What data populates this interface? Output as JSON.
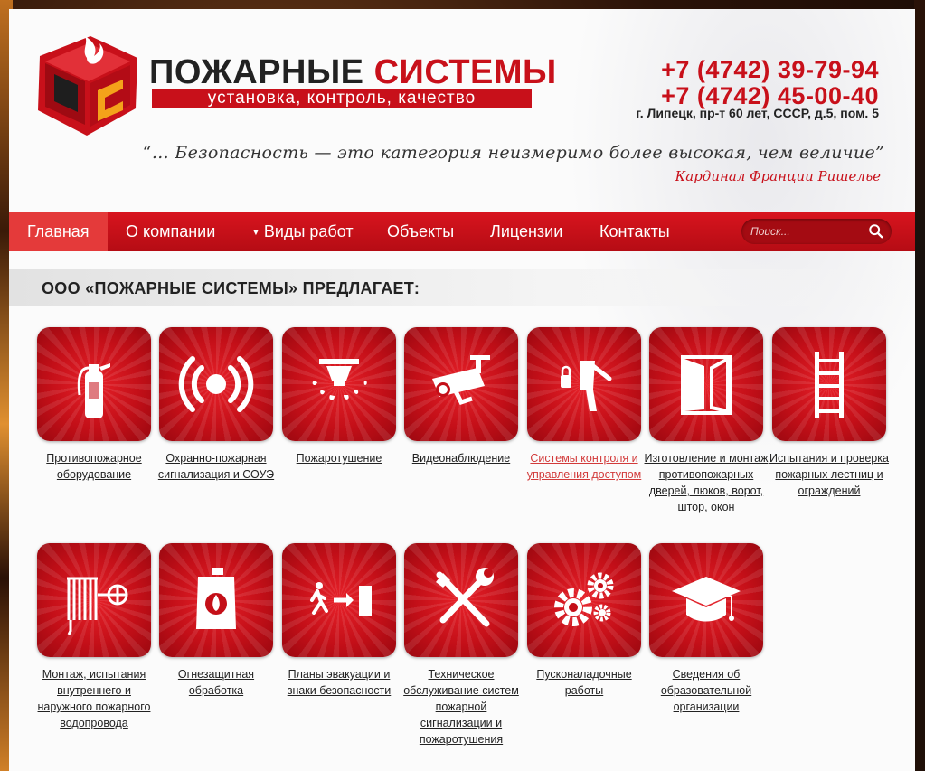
{
  "header": {
    "brand_word1": "ПОЖАРНЫЕ",
    "brand_word2": "СИСТЕМЫ",
    "tagline": "установка, контроль, качество",
    "phone1": "+7 (4742) 39-79-94",
    "phone2": "+7 (4742) 45-00-40",
    "address": "г. Липецк, пр-т 60 лет, СССР, д.5, пом. 5",
    "quote": "“… Безопасность — это категория неизмеримо более высокая, чем величие”",
    "quote_author": "Кардинал Франции Ришелье"
  },
  "nav": {
    "items": [
      {
        "label": "Главная",
        "active": true
      },
      {
        "label": "О компании",
        "active": false
      },
      {
        "label": "Виды работ",
        "active": false,
        "has_dropdown": true
      },
      {
        "label": "Объекты",
        "active": false
      },
      {
        "label": "Лицензии",
        "active": false
      },
      {
        "label": "Контакты",
        "active": false
      }
    ],
    "search_placeholder": "Поиск..."
  },
  "section": {
    "title": "ООО «ПОЖАРНЫЕ СИСТЕМЫ» ПРЕДЛАГАЕТ:"
  },
  "tiles": [
    {
      "label": "Противопожарное оборудование",
      "icon": "extinguisher-icon"
    },
    {
      "label": "Охранно-пожарная сигнализация и СОУЭ",
      "icon": "alarm-signal-icon"
    },
    {
      "label": "Пожаротушение",
      "icon": "sprinkler-icon"
    },
    {
      "label": "Видеонаблюдение",
      "icon": "cctv-camera-icon"
    },
    {
      "label": "Системы контроля и управления доступом",
      "icon": "turnstile-icon",
      "highlighted": true
    },
    {
      "label": "Изготовление и монтаж противопожарных дверей, люков, ворот, штор, окон",
      "icon": "door-icon"
    },
    {
      "label": "Испытания и проверка пожарных лестниц и ограждений",
      "icon": "ladder-icon"
    },
    {
      "label": "Монтаж, испытания внутреннего и наружного пожарного водопровода",
      "icon": "fire-hose-icon"
    },
    {
      "label": "Огнезащитная обработка",
      "icon": "canister-icon"
    },
    {
      "label": "Планы эвакуации и знаки безопасности",
      "icon": "exit-sign-icon"
    },
    {
      "label": "Техническое обслуживание систем пожарной сигнализации и пожаротушения",
      "icon": "tools-icon"
    },
    {
      "label": "Пусконаладочные работы",
      "icon": "gears-icon"
    },
    {
      "label": "Сведения об образовательной организации",
      "icon": "graduation-cap-icon"
    }
  ],
  "colors": {
    "brand_red": "#c8101a",
    "nav_red": "#d8141e",
    "nav_active": "#e43a3a",
    "highlight_link": "#d23a3a"
  }
}
